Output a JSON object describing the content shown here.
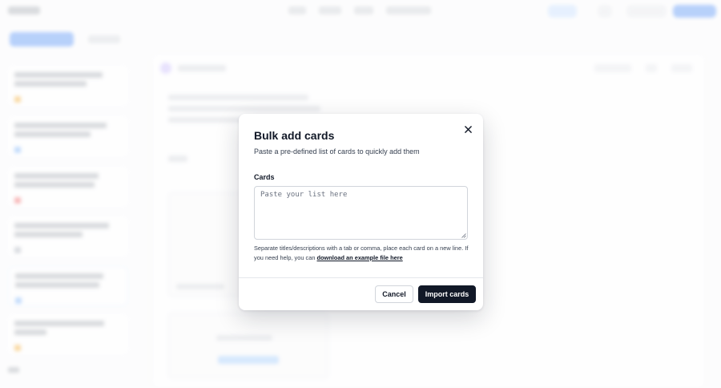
{
  "modal": {
    "title": "Bulk add cards",
    "subtitle": "Paste a pre-defined list of cards to quickly add them",
    "field_label": "Cards",
    "input_placeholder": "Paste your list here",
    "input_value": "",
    "help_text": "Separate titles/descriptions with a tab or comma, place each card on a new line. If you need help, you can",
    "help_link": "download an example file here",
    "cancel_label": "Cancel",
    "import_label": "Import cards",
    "close_icon": "close-icon"
  },
  "colors": {
    "primary": "#111827",
    "accent": "#3b82f6",
    "border": "#d1d5db"
  }
}
